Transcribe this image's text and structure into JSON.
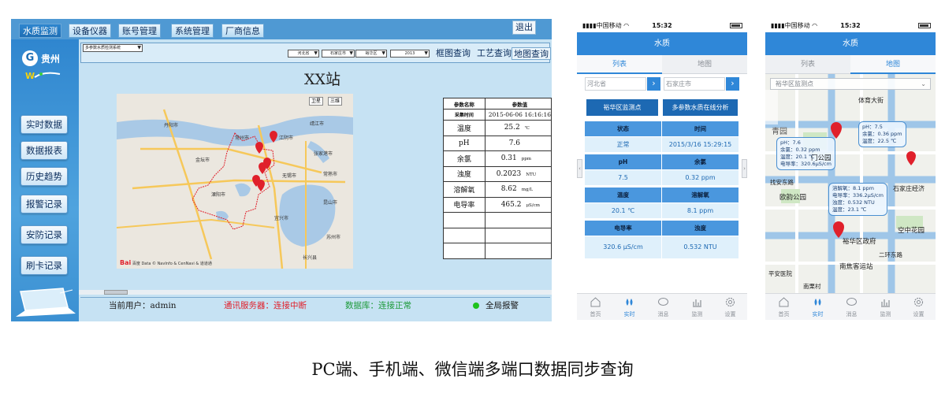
{
  "pc": {
    "nav_tabs": [
      "水质监测",
      "设备仪器",
      "账号管理",
      "系统管理",
      "厂商信息"
    ],
    "exit_label": "退出",
    "logo_text": "贵州",
    "side_menu": [
      "实时数据",
      "数据报表",
      "历史趋势",
      "报警记录",
      "安防记录",
      "刷卡记录"
    ],
    "system_select": "多参数水质检测系统",
    "filters": [
      "河北省",
      "石家庄市",
      "裕华区",
      "2013"
    ],
    "view_buttons": [
      "框图查询",
      "工艺查询",
      "地图查询"
    ],
    "station_title": "XX站",
    "map": {
      "controls": [
        "卫星",
        "三维"
      ],
      "attribution": "Data © NavInfo & CenNavi & 道道通",
      "baidu_logo": "Bai",
      "baidu_logo_2": "百度",
      "places": [
        "靖江市",
        "江阴市",
        "张家港市",
        "常熟市",
        "常州市",
        "无锡市",
        "苏州市",
        "宜兴市",
        "溧阳市",
        "金坛市",
        "丹阳市",
        "昆山市",
        "长兴县"
      ]
    },
    "param_table": {
      "headers": [
        "参数名称",
        "参数值"
      ],
      "timestamp_label": "采集时间",
      "timestamp": "2015-06-06 16:16:16",
      "rows": [
        {
          "name": "温度",
          "value": "25.2",
          "unit": "℃"
        },
        {
          "name": "pH",
          "value": "7.6",
          "unit": ""
        },
        {
          "name": "余氯",
          "value": "0.31",
          "unit": "ppm"
        },
        {
          "name": "浊度",
          "value": "0.2023",
          "unit": "NTU"
        },
        {
          "name": "溶解氧",
          "value": "8.62",
          "unit": "mg/L"
        },
        {
          "name": "电导率",
          "value": "465.2",
          "unit": "μS/cm"
        }
      ]
    },
    "status": {
      "user": "当前用户：admin",
      "comm": "通讯服务器：连接中断",
      "db": "数据库：连接正常",
      "alarm": "全局报警"
    }
  },
  "phone_common": {
    "carrier": "中国移动",
    "time": "15:32",
    "title": "水质",
    "tabs": [
      "列表",
      "地图"
    ],
    "nav": [
      "首页",
      "实时",
      "消息",
      "监测",
      "设置"
    ]
  },
  "phone1": {
    "province": "河北省",
    "city": "石家庄市",
    "go": "›",
    "btn_station": "裕华区监测点",
    "btn_analysis": "多参数水质在线分析",
    "grid": [
      [
        "状态",
        "时间"
      ],
      [
        "正常",
        "2015/3/16 15:29:15"
      ],
      [
        "pH",
        "余氯"
      ],
      [
        "7.5",
        "0.32 ppm"
      ],
      [
        "温度",
        "溶解氧"
      ],
      [
        "20.1 ℃",
        "8.1 ppm"
      ],
      [
        "电导率",
        "浊度"
      ],
      [
        "320.6 μS/cm",
        "0.532 NTU"
      ]
    ]
  },
  "phone2": {
    "select": "裕华区监测点",
    "bubbles": [
      [
        "pH：7.6",
        "余氯：0.32 ppm",
        "温度：20.1 ℃",
        "电导率：320.6μS/cm"
      ],
      [
        "pH：7.5",
        "余氯：0.36 ppm",
        "温度：22.5 ℃"
      ],
      [
        "溶解氧：8.1 ppm",
        "电导率：336.2μS/cm",
        "浊度：0.532 NTU",
        "温度：23.1 ℃"
      ]
    ],
    "labels": [
      "青园",
      "门公园",
      "找安东路",
      "欧韵公园",
      "石家庄经济",
      "空中花园",
      "裕华区政府",
      "南焦客运站",
      "平安医院",
      "二环东路",
      "南栗村",
      "体育大街"
    ]
  },
  "caption": "PC端、手机端、微信端多端口数据同步查询",
  "colors": {
    "accent": "#2f87d8",
    "pc_bg": "#c6e2f3",
    "marker": "#e0202b"
  }
}
